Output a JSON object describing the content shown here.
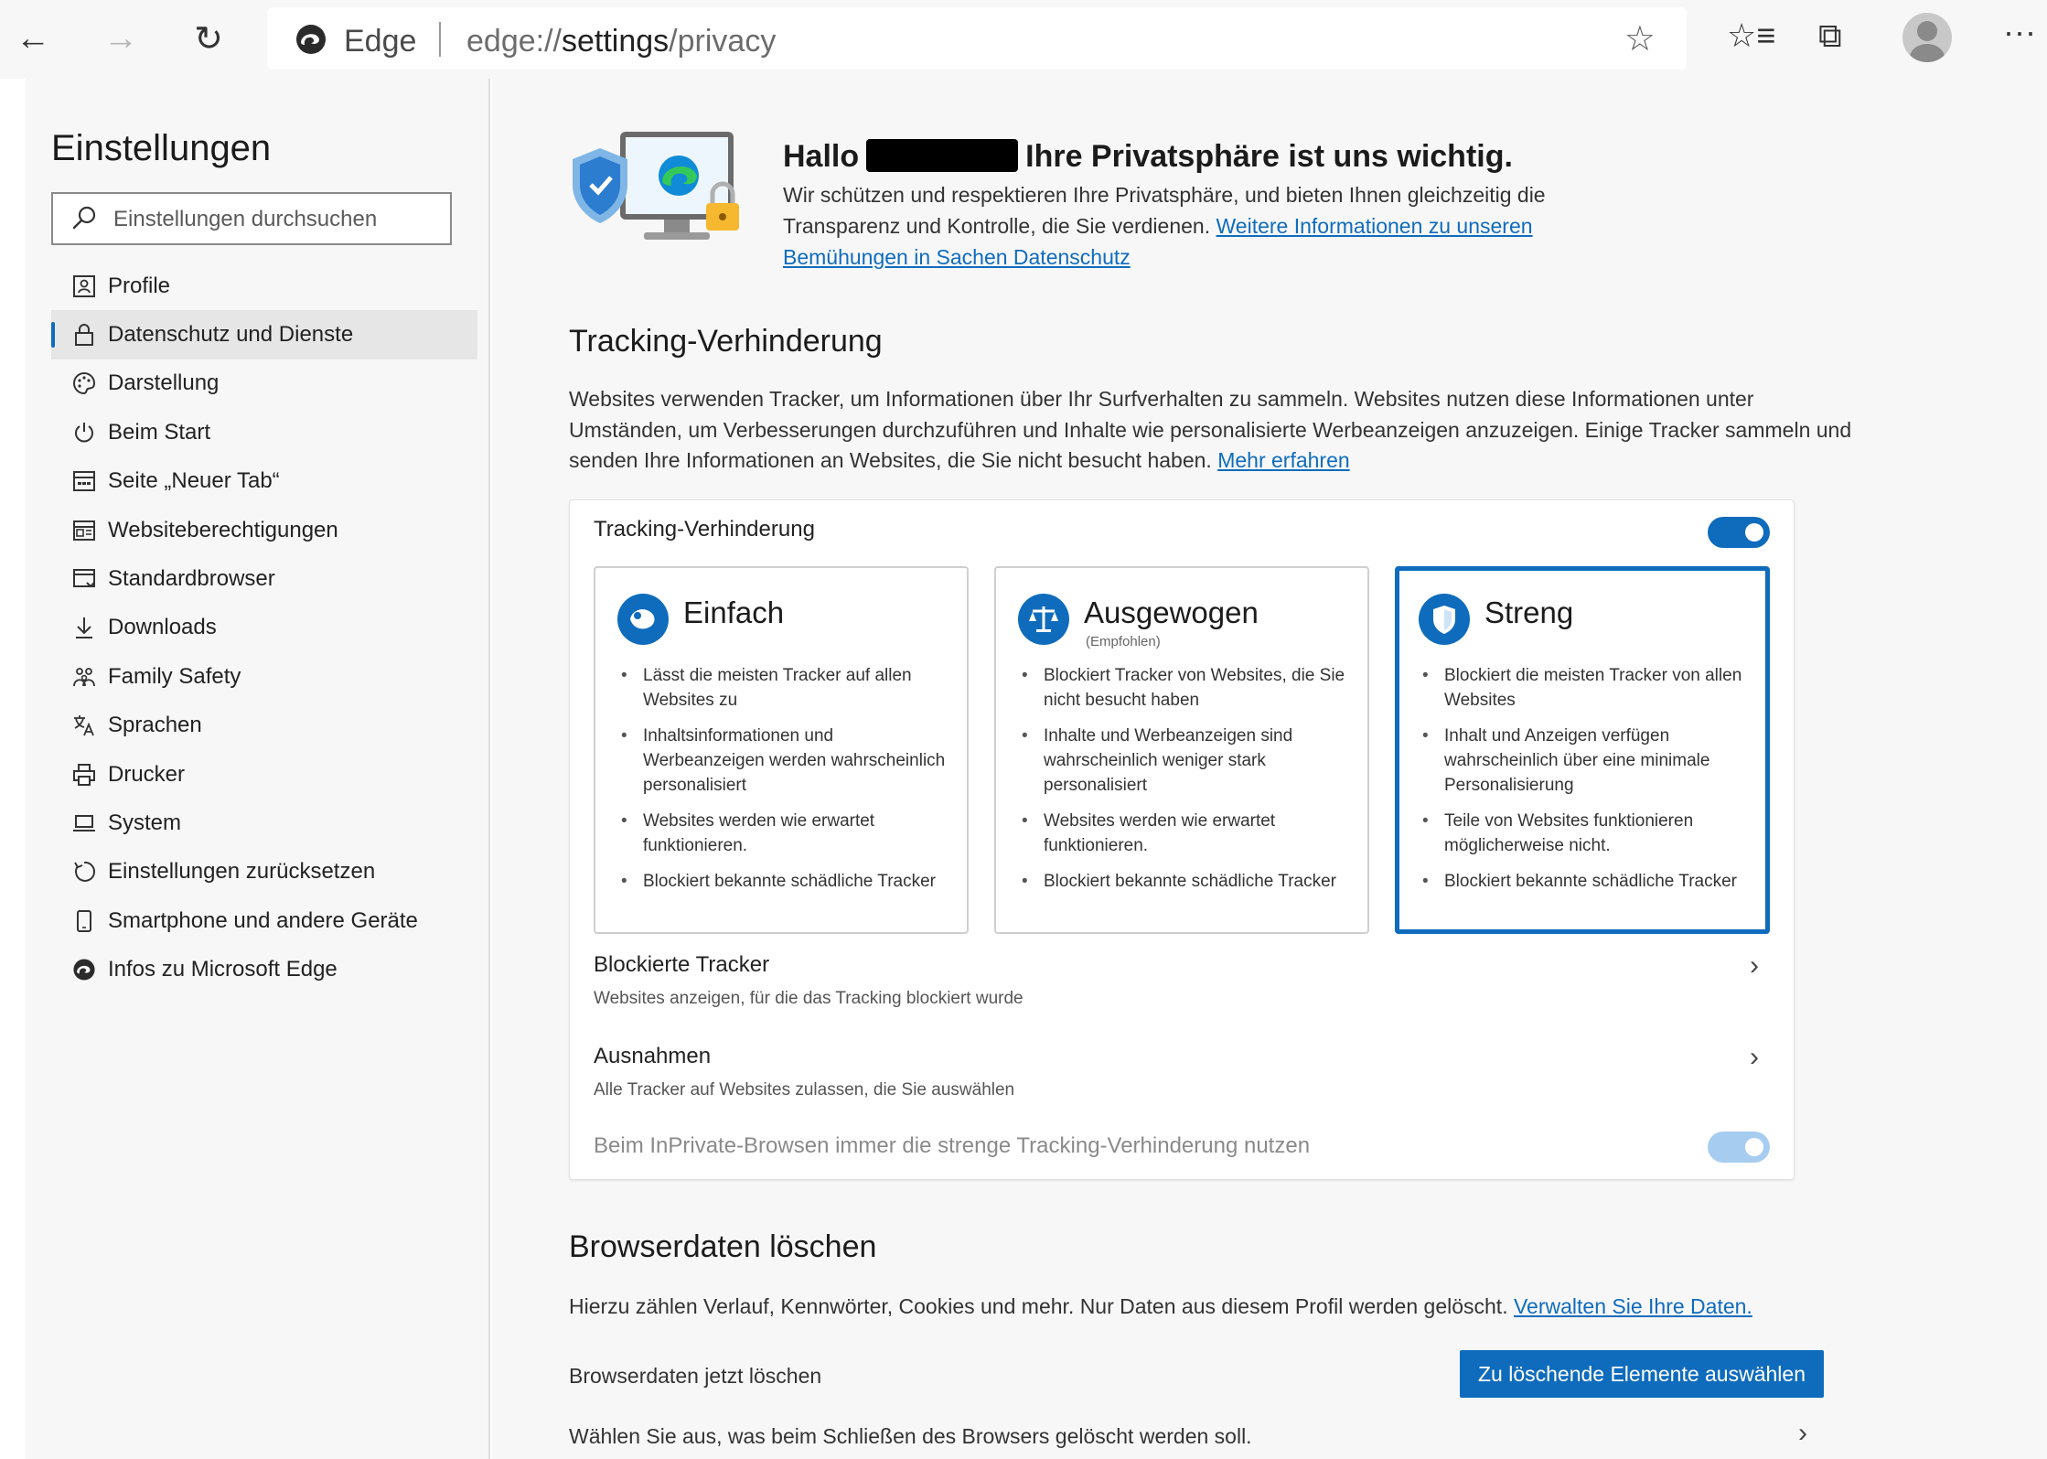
{
  "toolbar": {
    "back": "←",
    "forward": "→",
    "refresh": "↻",
    "browser_name": "Edge",
    "url_prefix": "edge://",
    "url_host": "settings",
    "url_path": "/privacy",
    "favorite_icon": "☆",
    "favorites_icon": "☆≡",
    "collections_icon": "⧉",
    "more_icon": "···"
  },
  "sidebar": {
    "title": "Einstellungen",
    "search_placeholder": "Einstellungen durchsuchen",
    "items": [
      {
        "label": "Profile",
        "icon": "profile-icon"
      },
      {
        "label": "Datenschutz und Dienste",
        "icon": "lock-icon",
        "active": true
      },
      {
        "label": "Darstellung",
        "icon": "palette-icon"
      },
      {
        "label": "Beim Start",
        "icon": "power-icon"
      },
      {
        "label": "Seite „Neuer Tab“",
        "icon": "new-tab-icon"
      },
      {
        "label": "Websiteberechtigungen",
        "icon": "site-permissions-icon"
      },
      {
        "label": "Standardbrowser",
        "icon": "default-browser-icon"
      },
      {
        "label": "Downloads",
        "icon": "download-icon"
      },
      {
        "label": "Family Safety",
        "icon": "family-icon"
      },
      {
        "label": "Sprachen",
        "icon": "language-icon"
      },
      {
        "label": "Drucker",
        "icon": "printer-icon"
      },
      {
        "label": "System",
        "icon": "laptop-icon"
      },
      {
        "label": "Einstellungen zurücksetzen",
        "icon": "reset-icon"
      },
      {
        "label": "Smartphone und andere Geräte",
        "icon": "phone-icon"
      },
      {
        "label": "Infos zu Microsoft Edge",
        "icon": "edge-icon"
      }
    ]
  },
  "hero": {
    "title_before": "Hallo",
    "title_after": "Ihre Privatsphäre ist uns wichtig.",
    "text": "Wir schützen und respektieren Ihre Privatsphäre, und bieten Ihnen gleichzeitig die Transparenz und Kontrolle, die Sie verdienen. ",
    "link": "Weitere Informationen zu unseren Bemühungen in Sachen Datenschutz"
  },
  "tracking": {
    "heading": "Tracking-Verhinderung",
    "description": "Websites verwenden Tracker, um Informationen über Ihr Surfverhalten zu sammeln. Websites nutzen diese Informationen unter Umständen, um Verbesserungen durchzuführen und Inhalte wie personalisierte Werbeanzeigen anzuzeigen. Einige Tracker sammeln und senden Ihre Informationen an Websites, die Sie nicht besucht haben. ",
    "learn_more": "Mehr erfahren",
    "card_title": "Tracking-Verhinderung",
    "options": [
      {
        "title": "Einfach",
        "subtitle": "",
        "bullets": [
          "Lässt die meisten Tracker auf allen Websites zu",
          "Inhaltsinformationen und Werbeanzeigen werden wahrscheinlich personalisiert",
          "Websites werden wie erwartet funktionieren.",
          "Blockiert bekannte schädliche Tracker"
        ]
      },
      {
        "title": "Ausgewogen",
        "subtitle": "(Empfohlen)",
        "bullets": [
          "Blockiert Tracker von Websites, die Sie nicht besucht haben",
          "Inhalte und Werbeanzeigen sind wahrscheinlich weniger stark personalisiert",
          "Websites werden wie erwartet funktionieren.",
          "Blockiert bekannte schädliche Tracker"
        ]
      },
      {
        "title": "Streng",
        "subtitle": "",
        "bullets": [
          "Blockiert die meisten Tracker von allen Websites",
          "Inhalt und Anzeigen verfügen wahrscheinlich über eine minimale Personalisierung",
          "Teile von Websites funktionieren möglicherweise nicht.",
          "Blockiert bekannte schädliche Tracker"
        ]
      }
    ],
    "blocked_title": "Blockierte Tracker",
    "blocked_sub": "Websites anzeigen, für die das Tracking blockiert wurde",
    "exceptions_title": "Ausnahmen",
    "exceptions_sub": "Alle Tracker auf Websites zulassen, die Sie auswählen",
    "inprivate_label": "Beim InPrivate-Browsen immer die strenge Tracking-Verhinderung nutzen",
    "chevron": "›"
  },
  "clear": {
    "heading": "Browserdaten löschen",
    "description": "Hierzu zählen Verlauf, Kennwörter, Cookies und mehr. Nur Daten aus diesem Profil werden gelöscht. ",
    "manage_link": "Verwalten Sie Ihre Daten.",
    "now_label": "Browserdaten jetzt löschen",
    "button": "Zu löschende Elemente auswählen",
    "on_close_label": "Wählen Sie aus, was beim Schließen des Browsers gelöscht werden soll.",
    "chevron": "›"
  },
  "colors": {
    "accent": "#0f6cbd",
    "toggle_disabled": "#a6cdf0"
  }
}
